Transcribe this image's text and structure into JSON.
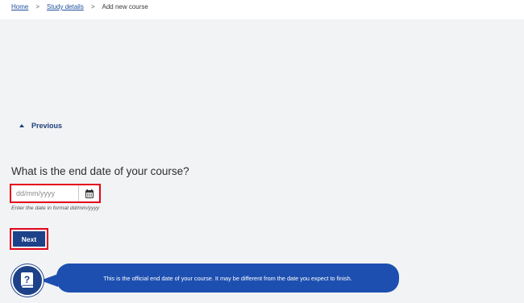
{
  "breadcrumb": {
    "items": [
      "Home",
      "Study details"
    ],
    "separator": ">",
    "current": "Add new course"
  },
  "previous": {
    "label": "Previous"
  },
  "question": {
    "title": "What is the end date of your course?"
  },
  "date_input": {
    "placeholder": "dd/mm/yyyy",
    "value": "",
    "hint": "Enter the date in format dd/mm/yyyy",
    "calendar_icon": "calendar-icon"
  },
  "next": {
    "label": "Next"
  },
  "help": {
    "icon": "help-book-icon",
    "message": "This is the official end date of your course. It may be different from the date you expect to finish."
  },
  "colors": {
    "primary": "#1d4289",
    "bubble": "#1d4fb0",
    "highlight": "#e3061a",
    "link": "#1f4e9c",
    "background": "#f2f3f5"
  }
}
